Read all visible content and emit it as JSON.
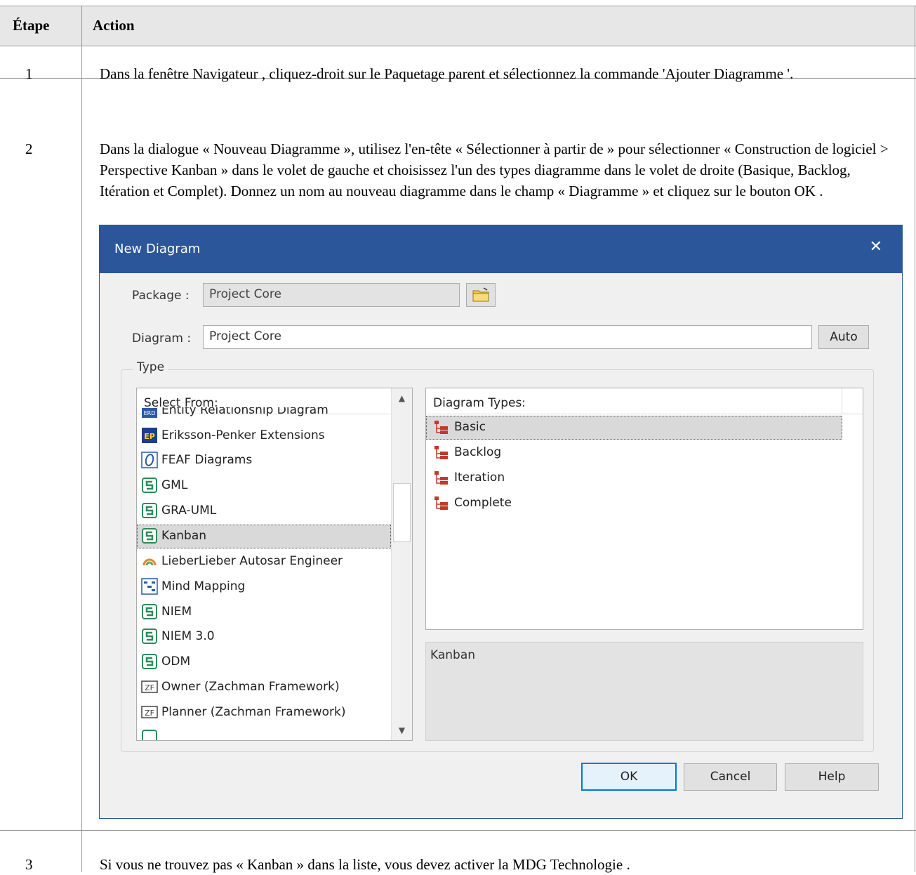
{
  "table": {
    "header": {
      "step": "Étape",
      "action": "Action"
    },
    "rows": [
      {
        "step": "1",
        "text": "Dans la fenêtre Navigateur , cliquez-droit sur le Paquetage parent et sélectionnez la commande 'Ajouter Diagramme '."
      },
      {
        "step": "2",
        "text": "Dans la dialogue « Nouveau Diagramme », utilisez l'en-tête « Sélectionner à partir de » pour sélectionner « Construction de logiciel > Perspective Kanban » dans le volet de gauche et choisissez l'un des types diagramme dans le volet de droite (Basique, Backlog, Itération et Complet). Donnez un nom au nouveau diagramme dans le champ « Diagramme » et cliquez sur le bouton OK ."
      },
      {
        "step": "3",
        "text": "Si vous ne trouvez pas « Kanban » dans la liste, vous devez activer la MDG Technologie ."
      }
    ]
  },
  "dialog": {
    "title": "New Diagram",
    "close_glyph": "✕",
    "package_label": "Package :",
    "package_value": "Project Core",
    "diagram_label": "Diagram :",
    "diagram_value": "Project Core",
    "auto_button": "Auto",
    "type_group_label": "Type",
    "select_from_header": "Select From:",
    "select_from_items": [
      "Entity Relationship Diagram",
      "Eriksson-Penker Extensions",
      "FEAF Diagrams",
      "GML",
      "GRA-UML",
      "Kanban",
      "LieberLieber Autosar Engineer",
      "Mind Mapping",
      "NIEM",
      "NIEM 3.0",
      "ODM",
      "Owner (Zachman Framework)",
      "Planner (Zachman Framework)"
    ],
    "diagram_types_header": "Diagram Types:",
    "diagram_types": [
      "Basic",
      "Backlog",
      "Iteration",
      "Complete"
    ],
    "description": "Kanban",
    "ok_button": "OK",
    "cancel_button": "Cancel",
    "help_button": "Help",
    "colors": {
      "title_bar": "#2b579a",
      "dialog_bg": "#f0f0f0",
      "selection": "#d9d9d9",
      "tech_icon": "#2e8b57"
    }
  }
}
